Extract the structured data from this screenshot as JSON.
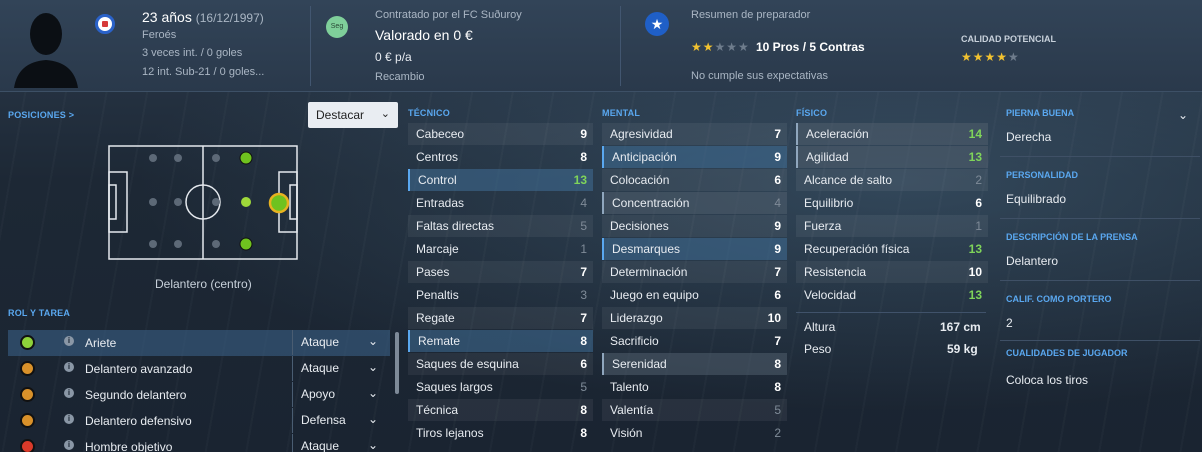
{
  "header": {
    "age": "23 años",
    "dob": "(16/12/1997)",
    "nationality": "Feroés",
    "caps": "3 veces int. / 0 goles",
    "u21_caps": "12 int. Sub-21 / 0 goles...",
    "contract_club": "Contratado por el FC Suðuroy",
    "value": "Valorado en 0 €",
    "wage": "0 € p/a",
    "squad_status": "Recambio",
    "seg_badge": "Seg",
    "coach_report_title": "Resumen de preparador",
    "coach_rating_stars": 2,
    "pros_cons": "10 Pros / 5 Contras",
    "expectations": "No cumple sus expectativas",
    "potential_label": "CALIDAD POTENCIAL",
    "potential_stars": 3.5
  },
  "left": {
    "positions_label": "POSICIONES >",
    "highlight_select": "Destacar",
    "position_name": "Delantero (centro)",
    "roles_label": "ROL Y TAREA",
    "roles": [
      {
        "name": "Ariete",
        "duty": "Ataque",
        "dot": "#8ed23a"
      },
      {
        "name": "Delantero avanzado",
        "duty": "Ataque",
        "dot": "#d9912a"
      },
      {
        "name": "Segundo delantero",
        "duty": "Apoyo",
        "dot": "#d9912a"
      },
      {
        "name": "Delantero defensivo",
        "duty": "Defensa",
        "dot": "#d9912a"
      },
      {
        "name": "Hombre objetivo",
        "duty": "Ataque",
        "dot": "#d93a2a"
      }
    ]
  },
  "technical": {
    "label": "TÉCNICO",
    "attrs": [
      {
        "name": "Cabeceo",
        "value": "9"
      },
      {
        "name": "Centros",
        "value": "8"
      },
      {
        "name": "Control",
        "value": "13"
      },
      {
        "name": "Entradas",
        "value": "4"
      },
      {
        "name": "Faltas directas",
        "value": "5"
      },
      {
        "name": "Marcaje",
        "value": "1"
      },
      {
        "name": "Pases",
        "value": "7"
      },
      {
        "name": "Penaltis",
        "value": "3"
      },
      {
        "name": "Regate",
        "value": "7"
      },
      {
        "name": "Remate",
        "value": "8"
      },
      {
        "name": "Saques de esquina",
        "value": "6"
      },
      {
        "name": "Saques largos",
        "value": "5"
      },
      {
        "name": "Técnica",
        "value": "8"
      },
      {
        "name": "Tiros lejanos",
        "value": "8"
      }
    ]
  },
  "mental": {
    "label": "MENTAL",
    "attrs": [
      {
        "name": "Agresividad",
        "value": "7"
      },
      {
        "name": "Anticipación",
        "value": "9"
      },
      {
        "name": "Colocación",
        "value": "6"
      },
      {
        "name": "Concentración",
        "value": "4"
      },
      {
        "name": "Decisiones",
        "value": "9"
      },
      {
        "name": "Desmarques",
        "value": "9"
      },
      {
        "name": "Determinación",
        "value": "7"
      },
      {
        "name": "Juego en equipo",
        "value": "6"
      },
      {
        "name": "Liderazgo",
        "value": "10"
      },
      {
        "name": "Sacrificio",
        "value": "7"
      },
      {
        "name": "Serenidad",
        "value": "8"
      },
      {
        "name": "Talento",
        "value": "8"
      },
      {
        "name": "Valentía",
        "value": "5"
      },
      {
        "name": "Visión",
        "value": "2"
      }
    ]
  },
  "physical": {
    "label": "FÍSICO",
    "attrs": [
      {
        "name": "Aceleración",
        "value": "14"
      },
      {
        "name": "Agilidad",
        "value": "13"
      },
      {
        "name": "Alcance de salto",
        "value": "2"
      },
      {
        "name": "Equilibrio",
        "value": "6"
      },
      {
        "name": "Fuerza",
        "value": "1"
      },
      {
        "name": "Recuperación física",
        "value": "13"
      },
      {
        "name": "Resistencia",
        "value": "10"
      },
      {
        "name": "Velocidad",
        "value": "13"
      }
    ],
    "height_label": "Altura",
    "height": "167 cm",
    "weight_label": "Peso",
    "weight": "59 kg"
  },
  "right": {
    "foot_label": "PIERNA BUENA",
    "foot": "Derecha",
    "personality_label": "PERSONALIDAD",
    "personality": "Equilibrado",
    "press_label": "DESCRIPCIÓN DE LA PRENSA",
    "press": "Delantero",
    "gk_label": "CALIF. COMO PORTERO",
    "gk": "2",
    "qualities_label": "CUALIDADES DE JUGADOR",
    "qualities": "Coloca los tiros"
  }
}
